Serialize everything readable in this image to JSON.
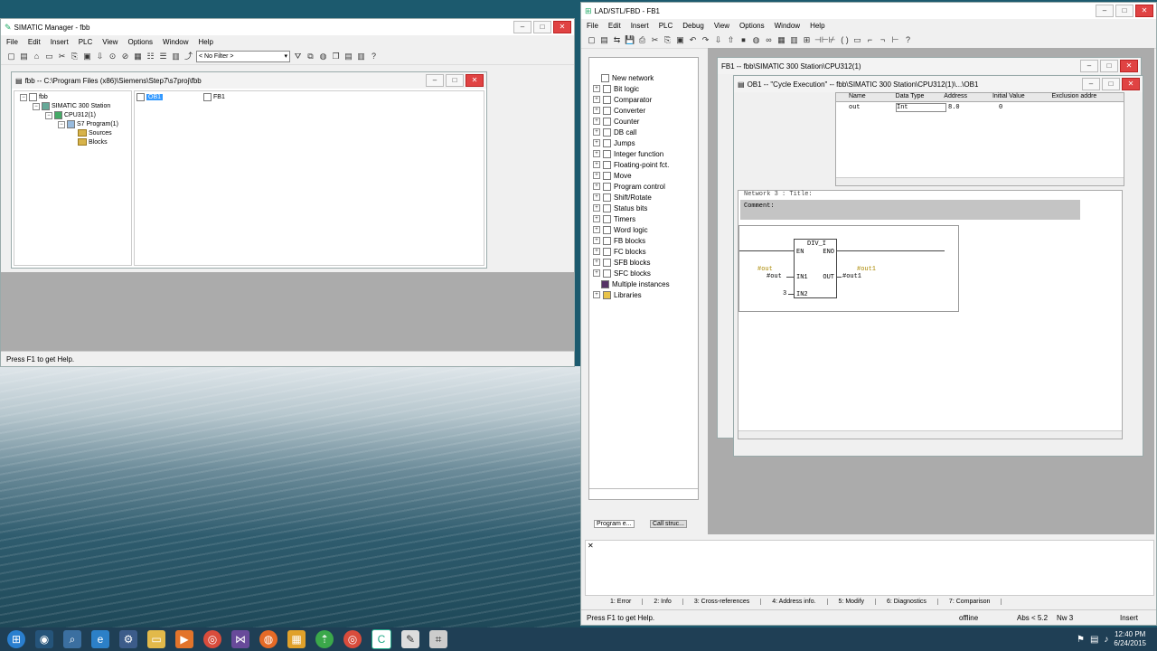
{
  "simatic": {
    "title": "SIMATIC Manager - fbb",
    "menu": [
      "File",
      "Edit",
      "Insert",
      "PLC",
      "View",
      "Options",
      "Window",
      "Help"
    ],
    "filter": "< No Filter >",
    "status": "Press F1 to get Help."
  },
  "project": {
    "title": "fbb -- C:\\Program Files (x86)\\Siemens\\Step7\\s7proj\\fbb",
    "tree": [
      "fbb",
      "SIMATIC 300 Station",
      "CPU312(1)",
      "S7 Program(1)",
      "Sources",
      "Blocks"
    ],
    "blocks": [
      "OB1",
      "FB1"
    ]
  },
  "lad": {
    "title": "LAD/STL/FBD - FB1",
    "menu": [
      "File",
      "Edit",
      "Insert",
      "PLC",
      "Debug",
      "View",
      "Options",
      "Window",
      "Help"
    ],
    "categories": [
      "New network",
      "Bit logic",
      "Comparator",
      "Converter",
      "Counter",
      "DB call",
      "Jumps",
      "Integer function",
      "Floating-point fct.",
      "Move",
      "Program control",
      "Shift/Rotate",
      "Status bits",
      "Timers",
      "Word logic",
      "FB blocks",
      "FC blocks",
      "SFB blocks",
      "SFC blocks",
      "Multiple instances",
      "Libraries"
    ],
    "left_tabs": [
      "Program e...",
      "Call struc..."
    ],
    "bottom_tabs": [
      "1: Error",
      "2: Info",
      "3: Cross-references",
      "4: Address info.",
      "5: Modify",
      "6: Diagnostics",
      "7: Comparison"
    ],
    "status": "Press F1 to get Help.",
    "status_offline": "offline",
    "status_abs": "Abs < 5.2",
    "status_nw": "Nw 3",
    "status_insert": "Insert"
  },
  "fb1": {
    "title": "FB1 -- fbb\\SIMATIC 300 Station\\CPU312(1)"
  },
  "ob1": {
    "title": "OB1 -- \"Cycle Execution\" -- fbb\\SIMATIC 300 Station\\CPU312(1)\\...\\OB1",
    "headers": [
      "Name",
      "Data Type",
      "Address",
      "Initial Value",
      "Exclusion addre"
    ],
    "row": [
      "out",
      "Int",
      "8.0",
      "0",
      ""
    ],
    "network_title": "Network 3 : Title:",
    "comment": "Comment:",
    "block_name": "DIV_I",
    "pins": {
      "en": "EN",
      "eno": "ENO",
      "in1": "IN1",
      "in2": "IN2",
      "out": "OUT"
    },
    "labels": {
      "in1_tag": "#out",
      "in1_var": "#out",
      "in2_val": "3",
      "out_tag": "#out1",
      "out_var": "#out1"
    }
  },
  "clock": {
    "time": "12:40 PM",
    "date": "6/24/2015"
  }
}
